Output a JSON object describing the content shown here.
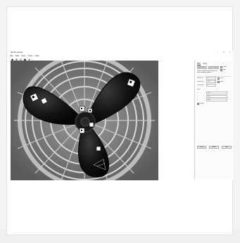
{
  "app": {
    "title": "3D Annotator",
    "window_controls": [
      "–",
      "□",
      "×"
    ]
  },
  "menu": [
    "File",
    "Edit",
    "View",
    "Tools",
    "Help"
  ],
  "toolbar": {
    "tools": [
      {
        "icon": "select-icon",
        "glyph": "◆"
      },
      {
        "icon": "zoom-in-icon",
        "glyph": "⊕"
      },
      {
        "icon": "zoom-out-icon",
        "glyph": "⊖"
      },
      {
        "icon": "fit-icon",
        "glyph": "▣"
      },
      {
        "icon": "measure-icon",
        "glyph": "⌖"
      }
    ]
  },
  "viewport": {
    "description_colors": {
      "background": "#6e6e6e",
      "blade": "#111111",
      "grille": "#cfcfcf"
    }
  },
  "panel": {
    "tabs": [
      "Obj",
      "Img"
    ],
    "active_tab": "Obj",
    "actions": {
      "add_label": "Add marker",
      "clear_label": "Clear markers"
    },
    "flag_a": "Show",
    "flag_b": "Grid",
    "info_text": "Select a marker then drag in the view to adjust position.",
    "rows": [
      {
        "label": "Marker ID",
        "value": "1",
        "flag": "Lock"
      },
      {
        "label": "Size (mm)",
        "value": "100",
        "flag": "Auto"
      },
      {
        "label": "Thickness",
        "value": "2",
        "flag": ""
      }
    ],
    "section_label": "Pose",
    "pose_fields": [
      {
        "label": "X",
        "value": "0.00"
      },
      {
        "label": "Y",
        "value": "0.00"
      },
      {
        "label": "Z",
        "value": "0.00"
      }
    ],
    "checkbox_label": "Refine",
    "bottom_buttons": [
      "Detect",
      "Export",
      "Save"
    ]
  }
}
